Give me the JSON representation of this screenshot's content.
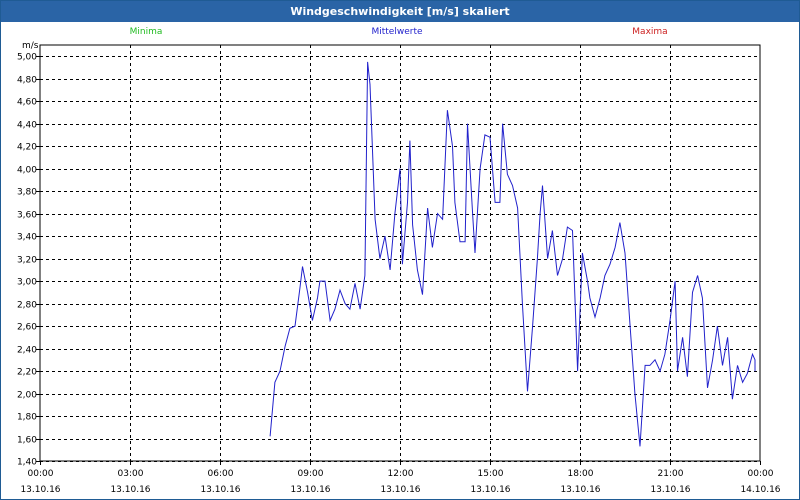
{
  "window": {
    "title": "Windgeschwindigkeit [m/s] skaliert"
  },
  "legend": [
    {
      "label": "Minima",
      "color": "#22bb22"
    },
    {
      "label": "Mittelwerte",
      "color": "#2222cc"
    },
    {
      "label": "Maxima",
      "color": "#cc2222"
    }
  ],
  "chart_data": {
    "type": "line",
    "title": "Windgeschwindigkeit [m/s] skaliert",
    "ylabel": "m/s",
    "ylim": [
      1.4,
      5.1
    ],
    "yticks": [
      "5,00",
      "4,80",
      "4,60",
      "4,40",
      "4,20",
      "4,00",
      "3,80",
      "3,60",
      "3,40",
      "3,20",
      "3,00",
      "2,80",
      "2,60",
      "2,40",
      "2,20",
      "2,00",
      "1,80",
      "1,60",
      "1,40"
    ],
    "ytick_values": [
      5.0,
      4.8,
      4.6,
      4.4,
      4.2,
      4.0,
      3.8,
      3.6,
      3.4,
      3.2,
      3.0,
      2.8,
      2.6,
      2.4,
      2.2,
      2.0,
      1.8,
      1.6,
      1.4
    ],
    "xlim": [
      0,
      24
    ],
    "xticks": [
      {
        "time": "00:00",
        "date": "13.10.16",
        "h": 0
      },
      {
        "time": "03:00",
        "date": "13.10.16",
        "h": 3
      },
      {
        "time": "06:00",
        "date": "13.10.16",
        "h": 6
      },
      {
        "time": "09:00",
        "date": "13.10.16",
        "h": 9
      },
      {
        "time": "12:00",
        "date": "13.10.16",
        "h": 12
      },
      {
        "time": "15:00",
        "date": "13.10.16",
        "h": 15
      },
      {
        "time": "18:00",
        "date": "13.10.16",
        "h": 18
      },
      {
        "time": "21:00",
        "date": "13.10.16",
        "h": 21
      },
      {
        "time": "00:00",
        "date": "14.10.16",
        "h": 24
      }
    ],
    "grid": true,
    "legend_position": "top",
    "series": [
      {
        "name": "Mittelwerte",
        "color": "#2222cc",
        "points": [
          [
            7.67,
            1.62
          ],
          [
            7.83,
            2.1
          ],
          [
            8.0,
            2.2
          ],
          [
            8.17,
            2.42
          ],
          [
            8.33,
            2.58
          ],
          [
            8.5,
            2.6
          ],
          [
            8.67,
            2.95
          ],
          [
            8.75,
            3.13
          ],
          [
            8.92,
            2.9
          ],
          [
            9.08,
            2.65
          ],
          [
            9.25,
            2.85
          ],
          [
            9.33,
            3.0
          ],
          [
            9.5,
            3.0
          ],
          [
            9.67,
            2.65
          ],
          [
            9.83,
            2.75
          ],
          [
            10.0,
            2.92
          ],
          [
            10.17,
            2.8
          ],
          [
            10.33,
            2.75
          ],
          [
            10.5,
            2.98
          ],
          [
            10.67,
            2.75
          ],
          [
            10.83,
            3.05
          ],
          [
            10.92,
            4.95
          ],
          [
            11.0,
            4.75
          ],
          [
            11.17,
            3.55
          ],
          [
            11.33,
            3.2
          ],
          [
            11.5,
            3.4
          ],
          [
            11.67,
            3.1
          ],
          [
            11.83,
            3.6
          ],
          [
            12.0,
            4.0
          ],
          [
            12.08,
            3.15
          ],
          [
            12.25,
            3.7
          ],
          [
            12.33,
            4.25
          ],
          [
            12.42,
            3.5
          ],
          [
            12.58,
            3.1
          ],
          [
            12.75,
            2.88
          ],
          [
            12.92,
            3.65
          ],
          [
            13.08,
            3.3
          ],
          [
            13.25,
            3.6
          ],
          [
            13.42,
            3.55
          ],
          [
            13.58,
            4.52
          ],
          [
            13.75,
            4.2
          ],
          [
            13.83,
            3.7
          ],
          [
            14.0,
            3.35
          ],
          [
            14.17,
            3.35
          ],
          [
            14.25,
            4.4
          ],
          [
            14.42,
            3.6
          ],
          [
            14.5,
            3.25
          ],
          [
            14.67,
            4.0
          ],
          [
            14.83,
            4.3
          ],
          [
            15.0,
            4.28
          ],
          [
            15.17,
            3.7
          ],
          [
            15.33,
            3.7
          ],
          [
            15.42,
            4.4
          ],
          [
            15.58,
            3.95
          ],
          [
            15.75,
            3.85
          ],
          [
            15.92,
            3.65
          ],
          [
            16.08,
            2.8
          ],
          [
            16.25,
            2.02
          ],
          [
            16.42,
            2.6
          ],
          [
            16.58,
            3.2
          ],
          [
            16.67,
            3.6
          ],
          [
            16.75,
            3.85
          ],
          [
            16.92,
            3.2
          ],
          [
            17.08,
            3.45
          ],
          [
            17.25,
            3.05
          ],
          [
            17.42,
            3.2
          ],
          [
            17.58,
            3.48
          ],
          [
            17.75,
            3.45
          ],
          [
            17.92,
            2.2
          ],
          [
            18.08,
            3.25
          ],
          [
            18.25,
            3.0
          ],
          [
            18.33,
            2.85
          ],
          [
            18.5,
            2.68
          ],
          [
            18.67,
            2.85
          ],
          [
            18.83,
            3.05
          ],
          [
            19.0,
            3.15
          ],
          [
            19.17,
            3.3
          ],
          [
            19.33,
            3.52
          ],
          [
            19.5,
            3.25
          ],
          [
            19.67,
            2.6
          ],
          [
            19.83,
            2.0
          ],
          [
            20.0,
            1.53
          ],
          [
            20.17,
            2.25
          ],
          [
            20.33,
            2.25
          ],
          [
            20.5,
            2.3
          ],
          [
            20.67,
            2.2
          ],
          [
            20.83,
            2.35
          ],
          [
            21.0,
            2.65
          ],
          [
            21.17,
            3.0
          ],
          [
            21.25,
            2.2
          ],
          [
            21.42,
            2.5
          ],
          [
            21.58,
            2.15
          ],
          [
            21.75,
            2.9
          ],
          [
            21.92,
            3.05
          ],
          [
            22.08,
            2.85
          ],
          [
            22.25,
            2.05
          ],
          [
            22.42,
            2.3
          ],
          [
            22.58,
            2.6
          ],
          [
            22.75,
            2.25
          ],
          [
            22.92,
            2.5
          ],
          [
            23.08,
            1.95
          ],
          [
            23.25,
            2.25
          ],
          [
            23.42,
            2.1
          ],
          [
            23.58,
            2.18
          ],
          [
            23.75,
            2.35
          ],
          [
            24.0,
            2.3
          ],
          [
            24.17,
            2.2
          ],
          [
            24.33,
            2.28
          ]
        ]
      }
    ]
  }
}
